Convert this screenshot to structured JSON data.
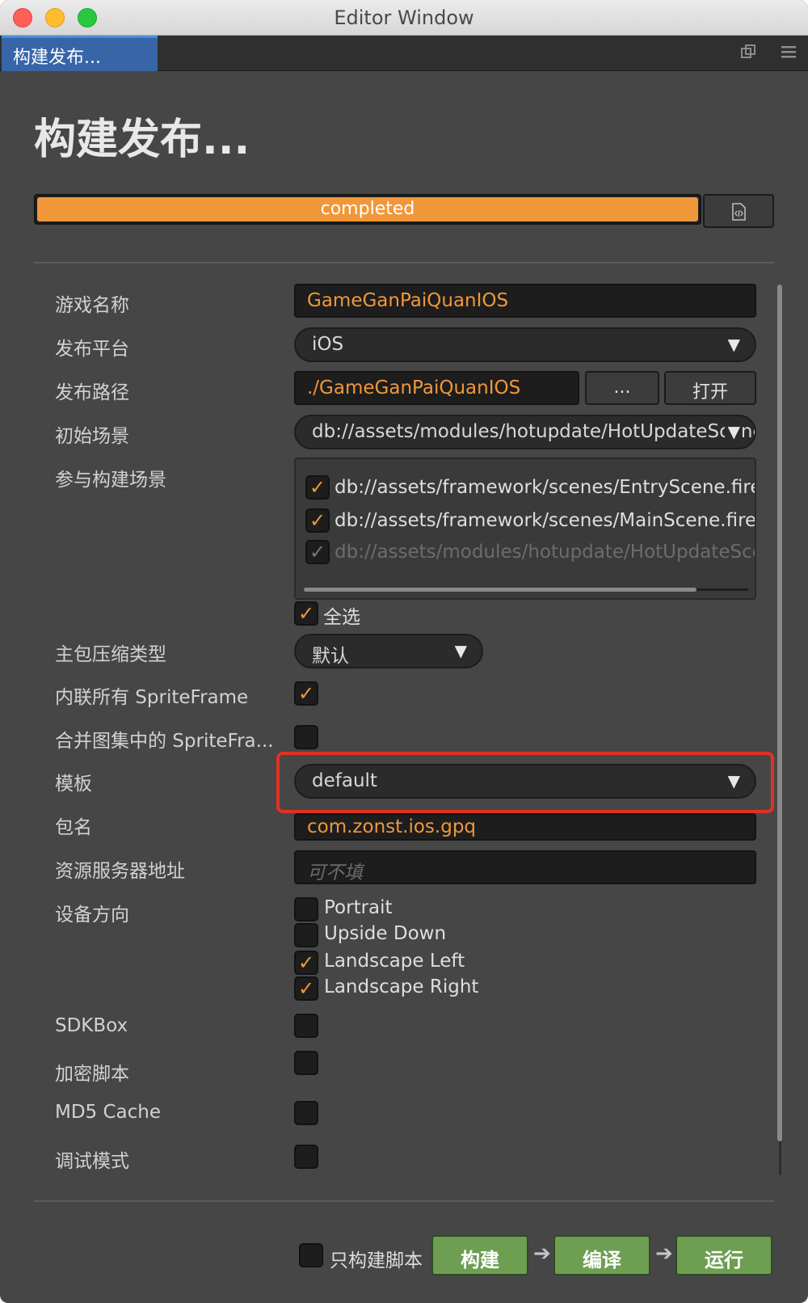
{
  "window": {
    "title": "Editor Window"
  },
  "tab": {
    "label": "构建发布..."
  },
  "icons": {
    "popout": "popout-window-icon",
    "menu": "hamburger-menu-icon",
    "log": "file-code-icon",
    "check": "checkmark-icon",
    "dropdown": "dropdown-arrow-icon",
    "flow": "arrow-right-icon"
  },
  "page": {
    "title": "构建发布..."
  },
  "progress": {
    "label": "completed",
    "value": 1.0
  },
  "form": {
    "game_name": {
      "label": "游戏名称",
      "value": "GameGanPaiQuanIOS"
    },
    "platform": {
      "label": "发布平台",
      "value": "iOS"
    },
    "build_path": {
      "label": "发布路径",
      "value": "./GameGanPaiQuanIOS",
      "browse": "...",
      "open": "打开"
    },
    "start_scene": {
      "label": "初始场景",
      "value": "db://assets/modules/hotupdate/HotUpdateScene.fire"
    },
    "scenes": {
      "label": "参与构建场景",
      "items": [
        {
          "path": "db://assets/framework/scenes/EntryScene.fire",
          "checked": true,
          "disabled": false
        },
        {
          "path": "db://assets/framework/scenes/MainScene.fire",
          "checked": true,
          "disabled": false
        },
        {
          "path": "db://assets/modules/hotupdate/HotUpdateScene.fire",
          "checked": true,
          "disabled": true
        }
      ],
      "select_all": "全选",
      "scroll_position": 0.88
    },
    "compression": {
      "label": "主包压缩类型",
      "value": "默认"
    },
    "inline_spriteframes": {
      "label": "内联所有 SpriteFrame",
      "checked": true
    },
    "merge_spriteframes": {
      "label": "合并图集中的 SpriteFra...",
      "checked": false
    },
    "template": {
      "label": "模板",
      "value": "default"
    },
    "package_name": {
      "label": "包名",
      "value": "com.zonst.ios.gpq"
    },
    "resource_server": {
      "label": "资源服务器地址",
      "placeholder": "可不填"
    },
    "orientation": {
      "label": "设备方向",
      "options": [
        {
          "label": "Portrait",
          "checked": false
        },
        {
          "label": "Upside Down",
          "checked": false
        },
        {
          "label": "Landscape Left",
          "checked": true
        },
        {
          "label": "Landscape Right",
          "checked": true
        }
      ]
    },
    "sdkbox": {
      "label": "SDKBox",
      "checked": false
    },
    "encrypt_js": {
      "label": "加密脚本",
      "checked": false
    },
    "md5_cache": {
      "label": "MD5 Cache",
      "checked": false
    },
    "debug": {
      "label": "调试模式",
      "checked": false
    }
  },
  "footer": {
    "script_only": {
      "label": "只构建脚本",
      "checked": false
    },
    "build": "构建",
    "compile": "编译",
    "run": "运行"
  },
  "colors": {
    "accent": "#f0973a",
    "action": "#6d9e52",
    "highlight": "#e03224",
    "tab": "#3765a7"
  }
}
